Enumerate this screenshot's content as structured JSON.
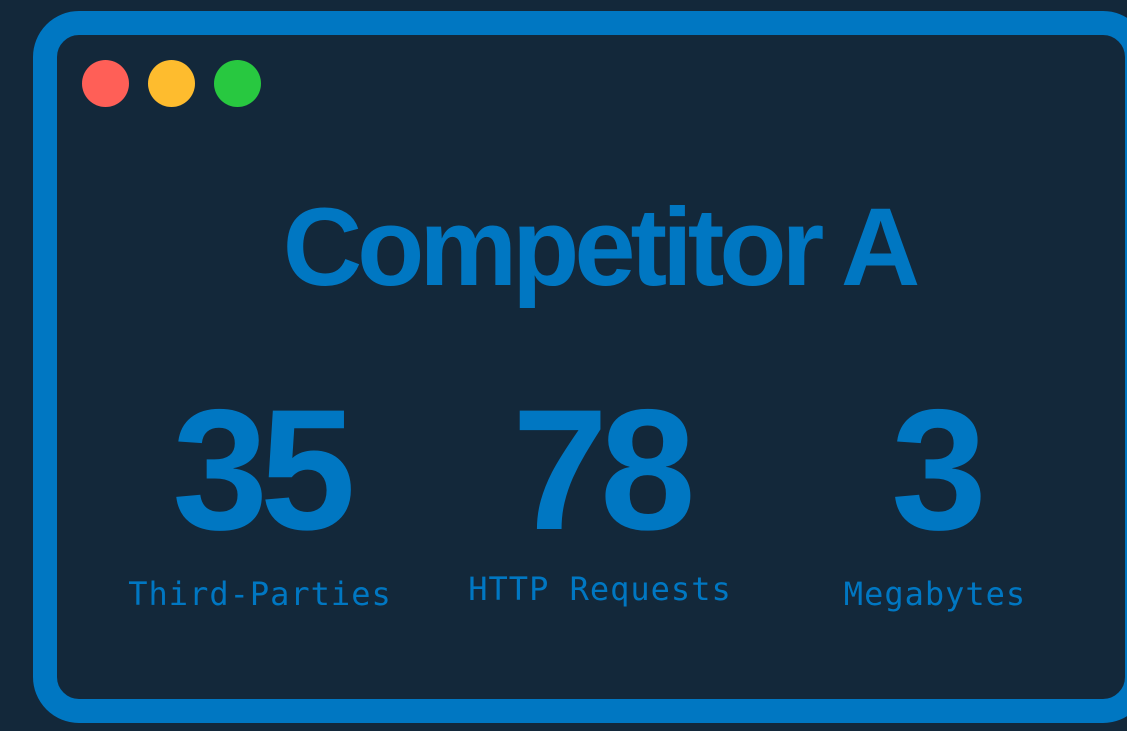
{
  "window": {
    "frame_color": "#0077c2",
    "background_color": "#13283a",
    "controls": [
      {
        "name": "close",
        "color": "#ff5f57"
      },
      {
        "name": "minimize",
        "color": "#febc2e"
      },
      {
        "name": "maximize",
        "color": "#28c840"
      }
    ]
  },
  "card": {
    "title": "Competitor A",
    "stats": [
      {
        "value": "35",
        "label": "Third-Parties"
      },
      {
        "value": "78",
        "label": "HTTP Requests"
      },
      {
        "value": "3",
        "label": "Megabytes"
      }
    ]
  }
}
